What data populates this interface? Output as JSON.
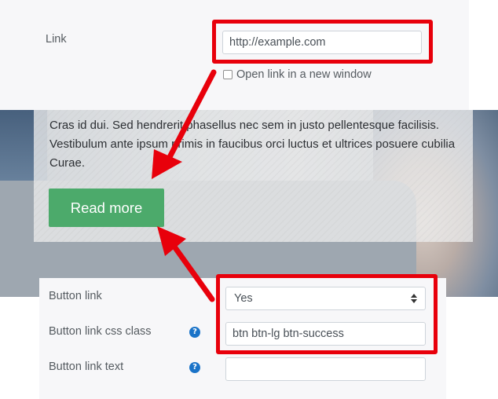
{
  "link_section": {
    "label": "Link",
    "url_value": "http://example.com",
    "new_window_label": "Open link in a new window",
    "new_window_checked": false
  },
  "preview": {
    "body_text": "Cras id dui. Sed hendrerit phasellus nec sem in justo pellentesque facilisis. Vestibulum ante ipsum primis in faucibus orci luctus et ultrices posuere cubilia Curae.",
    "button_label": "Read more",
    "button_color": "#4caa6b"
  },
  "button_settings": {
    "button_link_label": "Button link",
    "button_link_value": "Yes",
    "css_class_label": "Button link css class",
    "css_class_value": "btn btn-lg btn-success",
    "button_text_label": "Button link text",
    "button_text_value": ""
  },
  "annotation": {
    "highlight_color": "#e8000b"
  }
}
